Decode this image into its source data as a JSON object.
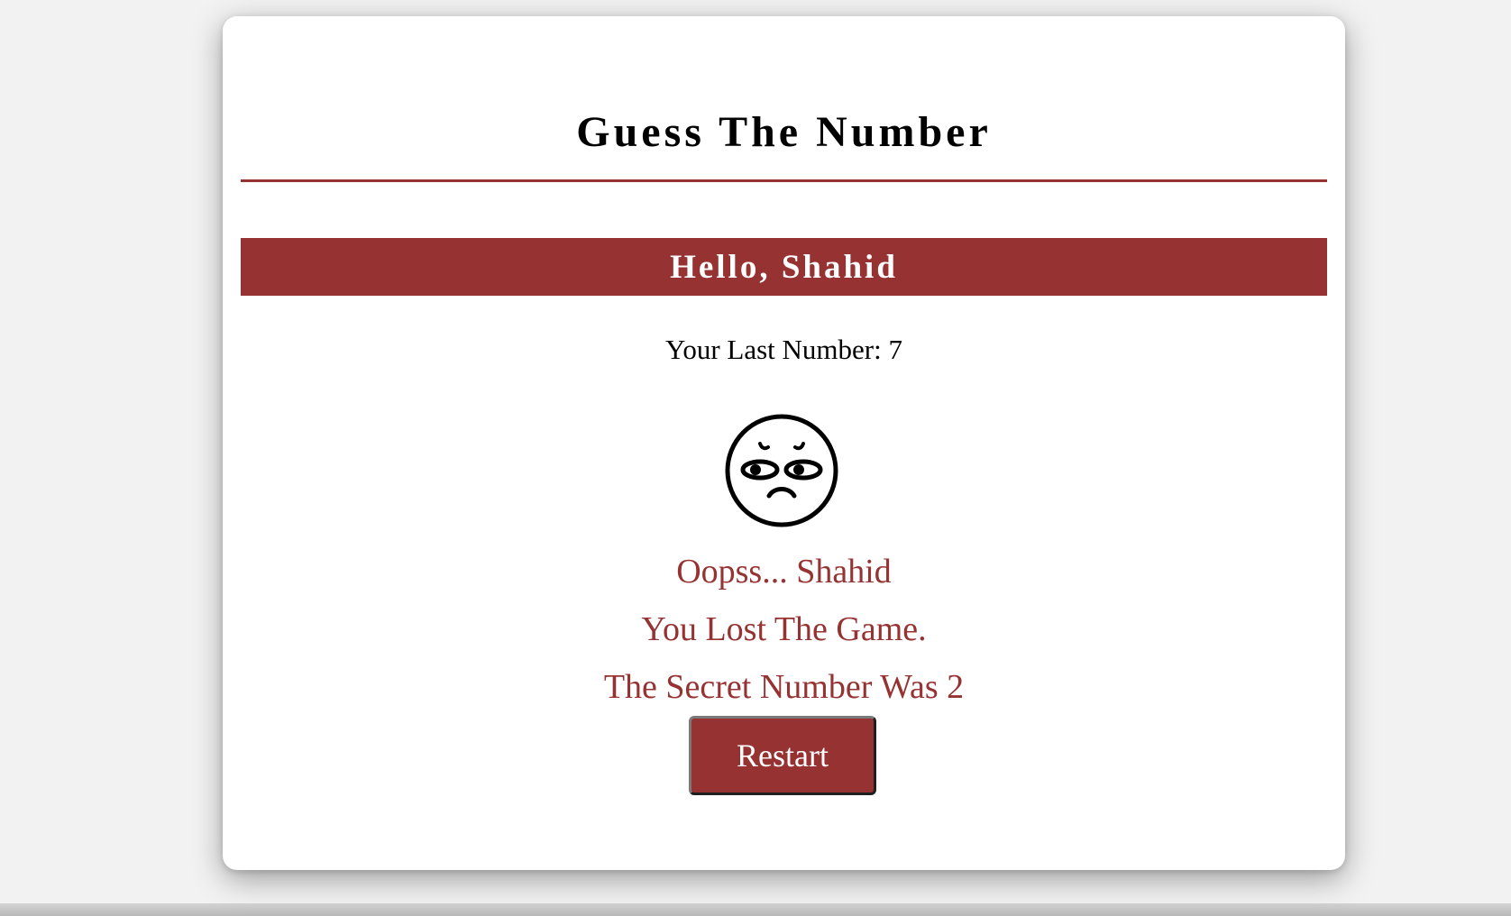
{
  "game": {
    "title": "Guess The Number",
    "greeting": "Hello, Shahid",
    "last_number_text": "Your Last Number: 7",
    "face_icon": "sad-face-icon",
    "result": {
      "line1": "Oopss... Shahid",
      "line2": "You Lost The Game.",
      "line3": "The Secret Number Was 2"
    },
    "restart_label": "Restart"
  },
  "colors": {
    "accent": "#963232",
    "background": "#f2f2f2",
    "card": "#ffffff"
  }
}
